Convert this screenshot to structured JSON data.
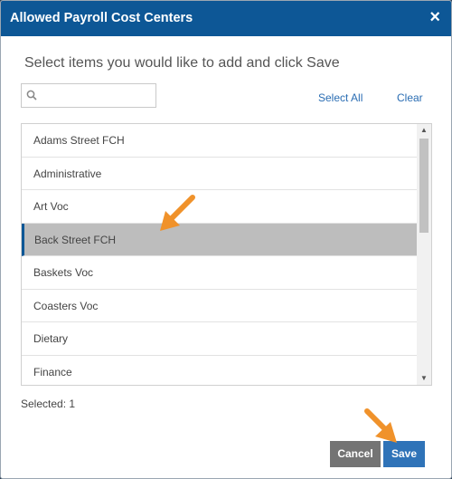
{
  "modal": {
    "title": "Allowed Payroll Cost Centers",
    "close_glyph": "×",
    "instructions": "Select items you would like to add and click Save"
  },
  "search": {
    "value": "",
    "placeholder": ""
  },
  "actions": {
    "select_all": "Select All",
    "clear": "Clear"
  },
  "list": {
    "items": [
      "Adams Street FCH",
      "Administrative",
      "Art Voc",
      "Back Street FCH",
      "Baskets Voc",
      "Coasters Voc",
      "Dietary",
      "Finance"
    ],
    "selected_item": "Back Street FCH"
  },
  "status": {
    "selected_count": "Selected: 1"
  },
  "footer": {
    "cancel_label": "Cancel",
    "save_label": "Save"
  },
  "colors": {
    "header": "#0d5796",
    "selected_row": "#bdbdbd",
    "annotation_arrow": "#f0922b",
    "save_button": "#2f73b8",
    "cancel_button": "#747474"
  },
  "icons": {
    "search": "search-icon",
    "close": "close-icon",
    "scroll_up": "scroll-up-arrow-icon",
    "scroll_down": "scroll-down-arrow-icon",
    "annotation": "annotation-arrow-icon"
  }
}
